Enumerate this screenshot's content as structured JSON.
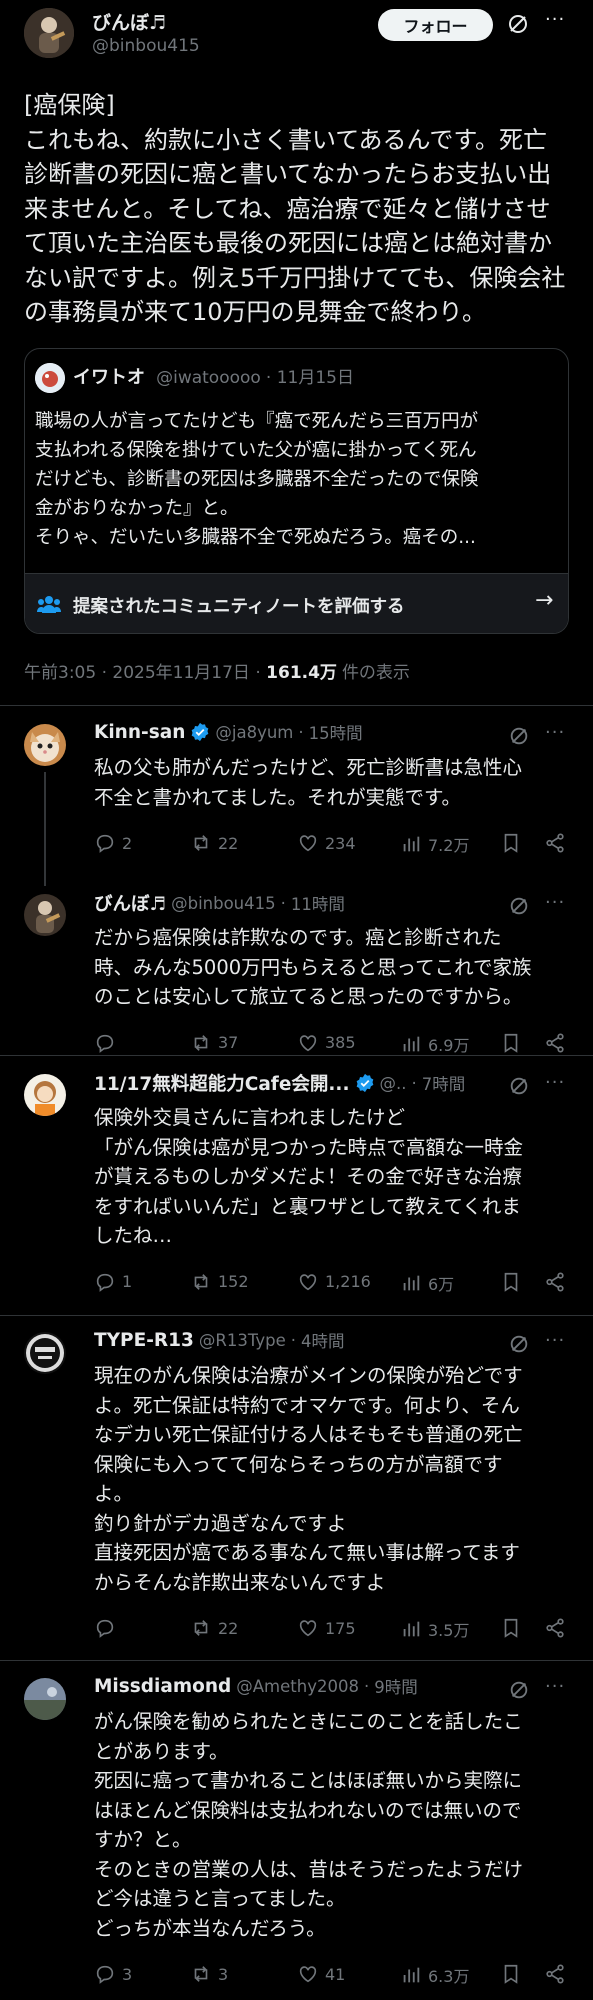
{
  "main_post": {
    "author_name": "びんぼ♬",
    "author_handle": "@binbou415",
    "follow_label": "フォロー",
    "body_lines": [
      "[癌保険]",
      "これもね、約款に小さく書いてあるんです。死亡",
      "診断書の死因に癌と書いてなかったらお支払い出",
      "来ませんと。そしてね、癌治療で延々と儲けさせ",
      "て頂いた主治医も最後の死因には癌とは絶対書か",
      "ない訳ですよ。例え5千万円掛けてても、保険会社",
      "の事務員が来て10万円の見舞金で終わり。"
    ],
    "quote": {
      "author_name": "イワトオ",
      "author_handle": "@iwatooooo",
      "date": "11月15日",
      "body_lines": [
        "職場の人が言ってたけども『癌で死んだら三百万円が",
        "支払われる保険を掛けていた父が癌に掛かってく死ん",
        "だけども、診断書の死因は多臓器不全だったので保険",
        "金がおりなかった』と。",
        "そりゃ、だいたい多臓器不全で死ぬだろう。癌その..."
      ],
      "community_note_label": "提案されたコミュニティノートを評価する"
    },
    "meta": {
      "time": "午前3:05",
      "date": "2025年11月17日",
      "views": "161.4万",
      "views_suffix": "件の表示"
    }
  },
  "replies": [
    {
      "author_name": "Kinn-san",
      "verified": true,
      "author_handle": "@ja8yum",
      "time": "15時間",
      "body_lines": [
        "私の父も肺がんだったけど、死亡診断書は急性心",
        "不全と書かれてました。それが実態です。"
      ],
      "replies": "2",
      "retweets": "22",
      "likes": "234",
      "views": "7.2万"
    },
    {
      "author_name": "びんぼ♬",
      "verified": false,
      "author_handle": "@binbou415",
      "time": "11時間",
      "body_lines": [
        "だから癌保険は詐欺なのです。癌と診断された",
        "時、みんな5000万円もらえると思ってこれで家族",
        "のことは安心して旅立てると思ったのですから。"
      ],
      "replies": "",
      "retweets": "37",
      "likes": "385",
      "views": "6.9万"
    },
    {
      "author_name": "11/17無料超能力Cafe会開...",
      "verified": true,
      "author_handle": "@..",
      "time": "7時間",
      "body_lines": [
        "保険外交員さんに言われましたけど",
        "「がん保険は癌が見つかった時点で高額な一時金",
        "が貰えるものしかダメだよ！その金で好きな治療",
        "をすればいいんだ」と裏ワザとして教えてくれま",
        "したね…"
      ],
      "replies": "1",
      "retweets": "152",
      "likes": "1,216",
      "views": "6万"
    },
    {
      "author_name": "TYPE-R13",
      "verified": false,
      "author_handle": "@R13Type",
      "time": "4時間",
      "body_lines": [
        "現在のがん保険は治療がメインの保険が殆どです",
        "よ。死亡保証は特約でオマケです。何より、そん",
        "なデカい死亡保証付ける人はそもそも普通の死亡",
        "保険にも入ってて何ならそっちの方が高額です",
        "よ。",
        "釣り針がデカ過ぎなんですよ",
        "直接死因が癌である事なんて無い事は解ってます",
        "からそんな詐欺出来ないんですよ"
      ],
      "replies": "",
      "retweets": "22",
      "likes": "175",
      "views": "3.5万"
    },
    {
      "author_name": "Missdiamond",
      "verified": false,
      "author_handle": "@Amethy2008",
      "time": "9時間",
      "body_lines": [
        "がん保険を勧められたときにこのことを話したこ",
        "とがあります。",
        "死因に癌って書かれることはほぼ無いから実際に",
        "はほとんど保険料は支払われないのでは無いので",
        "すか？と。",
        "そのときの営業の人は、昔はそうだったようだけ",
        "ど今は違うと言ってました。",
        "どっちが本当なんだろう。"
      ],
      "replies": "3",
      "retweets": "3",
      "likes": "41",
      "views": "6.3万"
    }
  ],
  "colors": {
    "background": "#000000",
    "text": "#e7e9ea",
    "muted": "#71767b",
    "verified": "#1d9bf0",
    "divider": "#2f3336"
  }
}
